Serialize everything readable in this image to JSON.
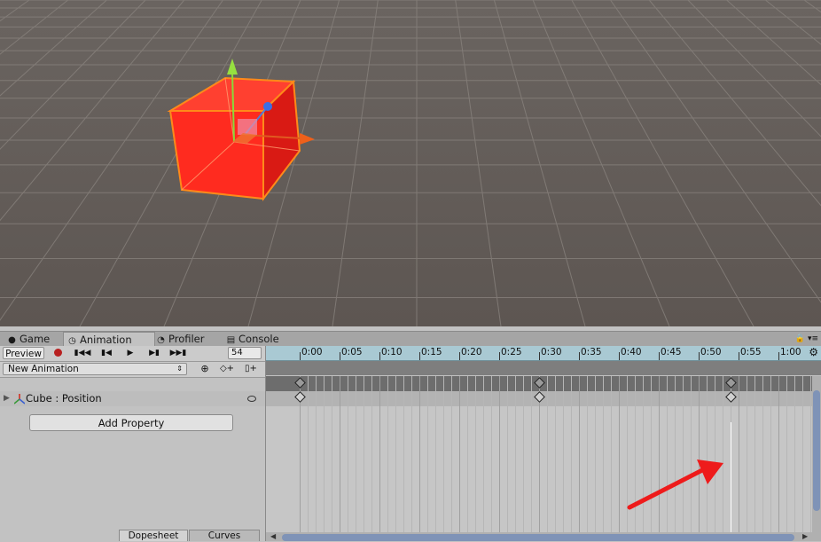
{
  "window_tabs": [
    {
      "label": "Game",
      "icon": "game-icon"
    },
    {
      "label": "Animation",
      "icon": "clock-icon"
    },
    {
      "label": "Profiler",
      "icon": "profiler-icon"
    },
    {
      "label": "Console",
      "icon": "console-icon"
    }
  ],
  "active_tab": "Animation",
  "toolbar": {
    "preview_label": "Preview",
    "frame_value": "54",
    "clip_name": "New Animation"
  },
  "property": {
    "object": "Cube",
    "name": "Position",
    "label": "Cube : Position"
  },
  "add_property_label": "Add Property",
  "bottom_tabs": [
    "Dopesheet",
    "Curves"
  ],
  "ruler_labels": [
    "0:00",
    "0:05",
    "0:10",
    "0:15",
    "0:20",
    "0:25",
    "0:30",
    "0:35",
    "0:40",
    "0:45",
    "0:50",
    "0:55",
    "1:00"
  ],
  "keyframes": [
    "0:00",
    "0:30",
    "0:54"
  ],
  "current_time": "0:54",
  "colors": {
    "ruler": "#a9c9d3",
    "cube": "#ff2b1f",
    "cube_outline": "#ff8a1a",
    "scene_bg": "#625b56",
    "record": "#b82020",
    "annotation_arrow": "#ee1b1b",
    "scrollbar_thumb": "#7f93b7"
  }
}
